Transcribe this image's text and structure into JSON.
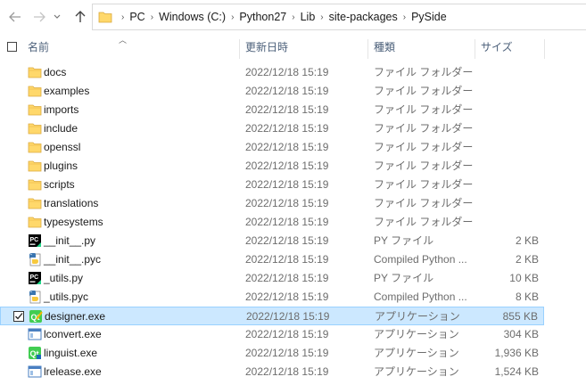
{
  "nav": {
    "breadcrumbs": [
      "PC",
      "Windows (C:)",
      "Python27",
      "Lib",
      "site-packages",
      "PySide"
    ]
  },
  "columns": {
    "name": "名前",
    "modified": "更新日時",
    "type": "種類",
    "size": "サイズ"
  },
  "files": [
    {
      "name": "docs",
      "modified": "2022/12/18 15:19",
      "type": "ファイル フォルダー",
      "size": "",
      "icon": "folder-icon"
    },
    {
      "name": "examples",
      "modified": "2022/12/18 15:19",
      "type": "ファイル フォルダー",
      "size": "",
      "icon": "folder-icon"
    },
    {
      "name": "imports",
      "modified": "2022/12/18 15:19",
      "type": "ファイル フォルダー",
      "size": "",
      "icon": "folder-icon"
    },
    {
      "name": "include",
      "modified": "2022/12/18 15:19",
      "type": "ファイル フォルダー",
      "size": "",
      "icon": "folder-icon"
    },
    {
      "name": "openssl",
      "modified": "2022/12/18 15:19",
      "type": "ファイル フォルダー",
      "size": "",
      "icon": "folder-icon"
    },
    {
      "name": "plugins",
      "modified": "2022/12/18 15:19",
      "type": "ファイル フォルダー",
      "size": "",
      "icon": "folder-icon"
    },
    {
      "name": "scripts",
      "modified": "2022/12/18 15:19",
      "type": "ファイル フォルダー",
      "size": "",
      "icon": "folder-icon"
    },
    {
      "name": "translations",
      "modified": "2022/12/18 15:19",
      "type": "ファイル フォルダー",
      "size": "",
      "icon": "folder-icon"
    },
    {
      "name": "typesystems",
      "modified": "2022/12/18 15:19",
      "type": "ファイル フォルダー",
      "size": "",
      "icon": "folder-icon"
    },
    {
      "name": "__init__.py",
      "modified": "2022/12/18 15:19",
      "type": "PY ファイル",
      "size": "2 KB",
      "icon": "pycharm-file-icon"
    },
    {
      "name": "__init__.pyc",
      "modified": "2022/12/18 15:19",
      "type": "Compiled Python ...",
      "size": "2 KB",
      "icon": "python-compiled-icon"
    },
    {
      "name": "_utils.py",
      "modified": "2022/12/18 15:19",
      "type": "PY ファイル",
      "size": "10 KB",
      "icon": "pycharm-file-icon"
    },
    {
      "name": "_utils.pyc",
      "modified": "2022/12/18 15:19",
      "type": "Compiled Python ...",
      "size": "8 KB",
      "icon": "python-compiled-icon"
    },
    {
      "name": "designer.exe",
      "modified": "2022/12/18 15:19",
      "type": "アプリケーション",
      "size": "855 KB",
      "icon": "qt-designer-icon",
      "selected": true
    },
    {
      "name": "lconvert.exe",
      "modified": "2022/12/18 15:19",
      "type": "アプリケーション",
      "size": "304 KB",
      "icon": "app-window-icon"
    },
    {
      "name": "linguist.exe",
      "modified": "2022/12/18 15:19",
      "type": "アプリケーション",
      "size": "1,936 KB",
      "icon": "qt-linguist-icon"
    },
    {
      "name": "lrelease.exe",
      "modified": "2022/12/18 15:19",
      "type": "アプリケーション",
      "size": "1,524 KB",
      "icon": "app-window-icon"
    }
  ]
}
